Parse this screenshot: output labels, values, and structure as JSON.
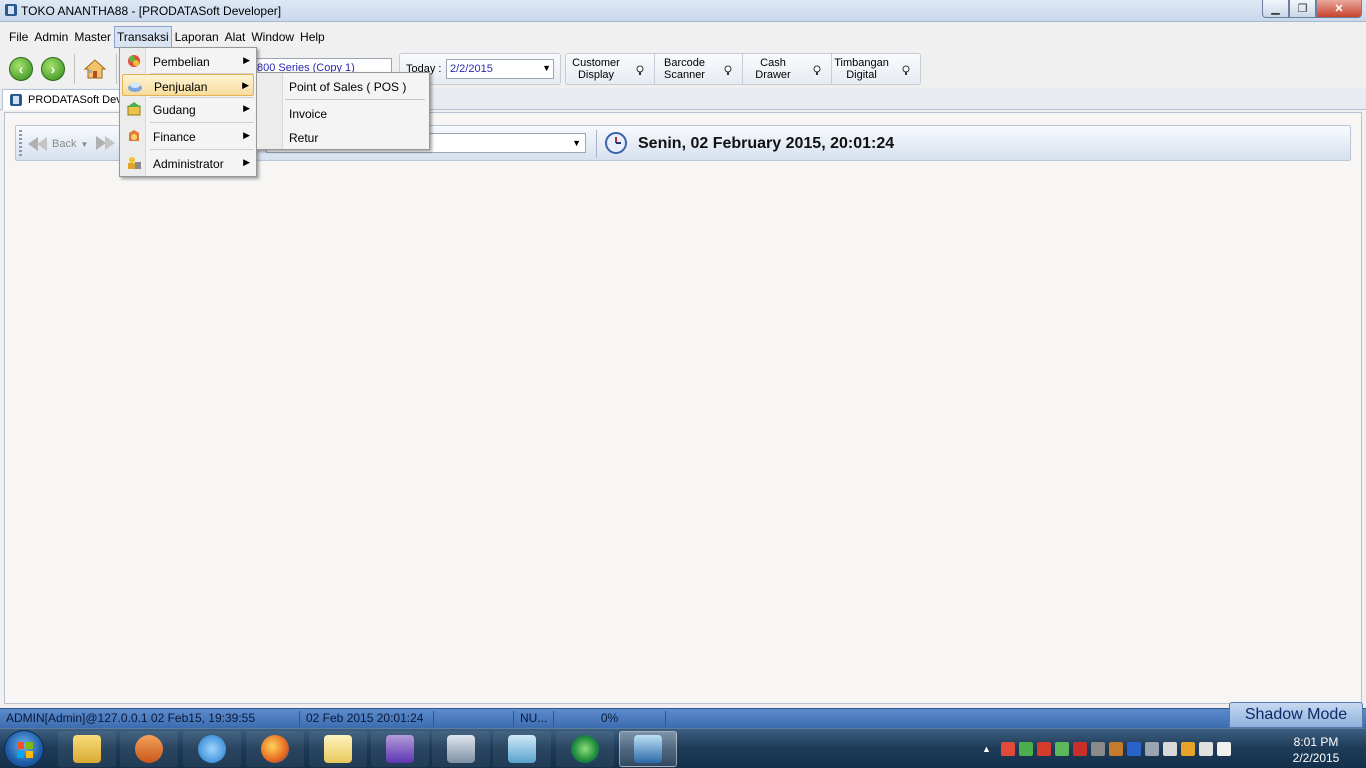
{
  "window": {
    "title": "TOKO ANANTHA88 - [PRODATASoft Developer]",
    "minimize": "▁",
    "restore": "❐",
    "close": "✕"
  },
  "menubar": [
    "File",
    "Admin",
    "Master",
    "Transaksi",
    "Laporan",
    "Alat",
    "Window",
    "Help"
  ],
  "toolbar": {
    "printer": "800 Series (Copy 1)",
    "today_label": "Today :",
    "today_value": "2/2/2015",
    "devices": [
      {
        "line1": "Customer",
        "line2": "Display"
      },
      {
        "line1": "Barcode",
        "line2": "Scanner"
      },
      {
        "line1": "Cash",
        "line2": "Drawer"
      },
      {
        "line1": "Timbangan",
        "line2": "Digital"
      }
    ]
  },
  "tab": {
    "label": "PRODATASoft Dev"
  },
  "navbar": {
    "back_label": "Back",
    "datetime": "Senin, 02 February 2015, 20:01:24"
  },
  "transaksi_menu": [
    {
      "label": "Pembelian",
      "icon": "pembelian-icon"
    },
    {
      "label": "Penjualan",
      "icon": "penjualan-icon"
    },
    {
      "label": "Gudang",
      "icon": "gudang-icon"
    },
    {
      "label": "Finance",
      "icon": "finance-icon"
    },
    {
      "label": "Administrator",
      "icon": "administrator-icon"
    }
  ],
  "penjualan_submenu": [
    "Point of Sales ( POS )",
    "Invoice",
    "Retur"
  ],
  "statusbar": {
    "user": "ADMIN[Admin]@127.0.0.1 02 Feb15, 19:39:55",
    "datetime": "02 Feb 2015 20:01:24",
    "numlock": "NU...",
    "progress": "0%",
    "shadow_mode": "Shadow Mode"
  },
  "taskbar": {
    "time": "8:01 PM",
    "date": "2/2/2015"
  },
  "colors": {
    "accent": "#3c6bb0",
    "menu_highlight": "#f7dc9c"
  }
}
